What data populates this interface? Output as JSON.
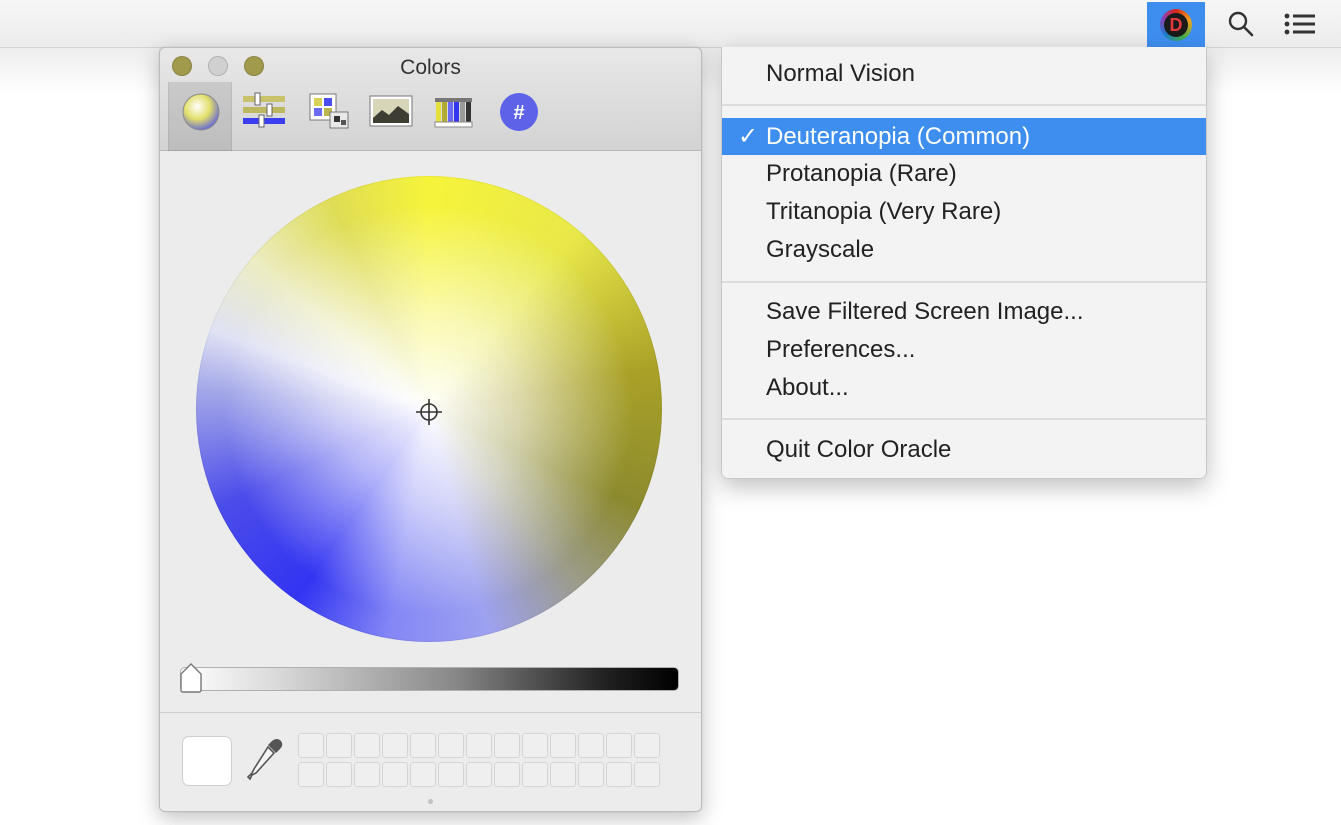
{
  "menubar": {
    "color_oracle_letter": "D",
    "icons": [
      "color-oracle-icon",
      "search-icon",
      "list-icon"
    ],
    "accent": "#3e8ef0"
  },
  "colors_panel": {
    "title": "Colors",
    "toolbar_tabs": [
      "color-wheel-icon",
      "color-sliders-icon",
      "color-palettes-icon",
      "image-palettes-icon",
      "pencils-icon",
      "hex-icon"
    ],
    "hex_tab_label": "#",
    "selected_tab": "color-wheel-icon",
    "brightness_level": 0.0,
    "current_color": "#ffffff"
  },
  "menu": {
    "check_mark": "✓",
    "items": [
      {
        "label": "Normal Vision"
      },
      {
        "label": "Deuteranopia (Common)"
      },
      {
        "label": "Protanopia (Rare)"
      },
      {
        "label": "Tritanopia (Very Rare)"
      },
      {
        "label": "Grayscale"
      },
      {
        "label": "Save Filtered Screen Image..."
      },
      {
        "label": "Preferences..."
      },
      {
        "label": "About..."
      },
      {
        "label": "Quit Color Oracle"
      }
    ],
    "selected_item": "Deuteranopia (Common)"
  }
}
